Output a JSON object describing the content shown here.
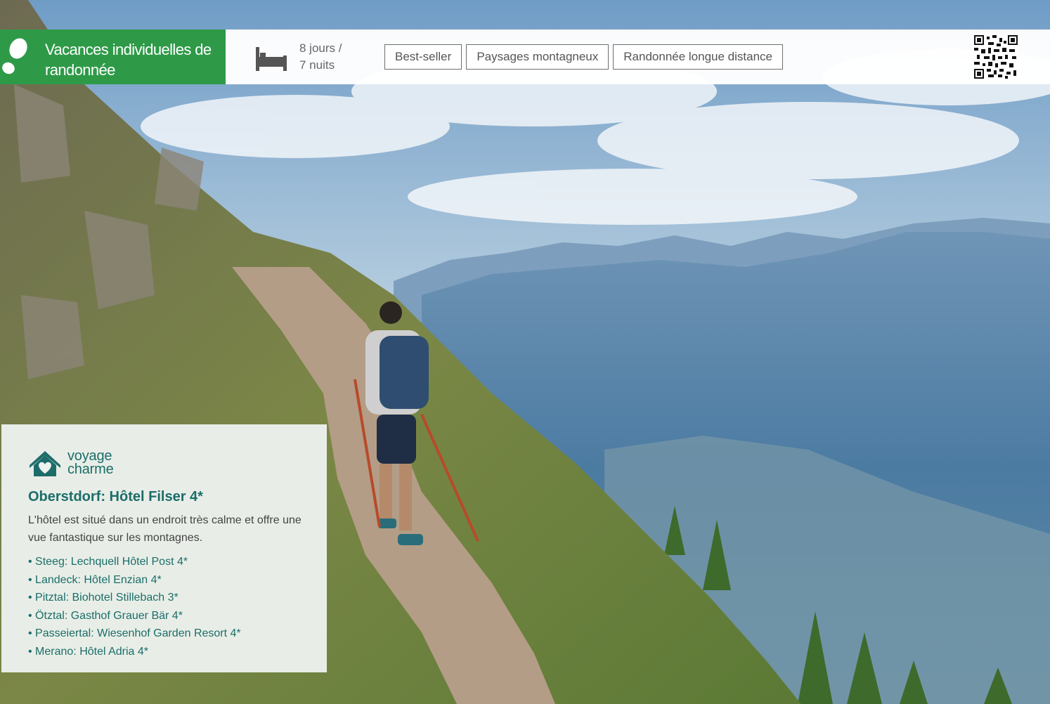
{
  "brand": {
    "title": "Vacances individuelles de randonnée",
    "icon": "footprint-icon",
    "color": "#2e9a48"
  },
  "duration": {
    "icon": "bed-icon",
    "text_line1": "8 jours /",
    "text_line2": "7 nuits"
  },
  "tags": [
    "Best-seller",
    "Paysages montagneux",
    "Randonnée longue distance"
  ],
  "qr": {
    "icon": "qr-code-icon"
  },
  "info": {
    "logo": {
      "icon": "voyage-charme-logo",
      "line1": "voyage",
      "line2": "charme"
    },
    "title": "Oberstdorf: Hôtel Filser 4*",
    "description": "L'hôtel est situé dans un endroit très calme et offre une vue fantastique sur les montagnes.",
    "stops": [
      "Steeg: Lechquell Hôtel Post 4*",
      "Landeck: Hôtel Enzian 4*",
      "Pitztal: Biohotel Stillebach 3*",
      "Ötztal: Gasthof Grauer Bär 4*",
      "Passeiertal: Wiesenhof Garden Resort 4*",
      "Merano: Hôtel Adria 4*"
    ],
    "accent_color": "#1c6d6a"
  }
}
